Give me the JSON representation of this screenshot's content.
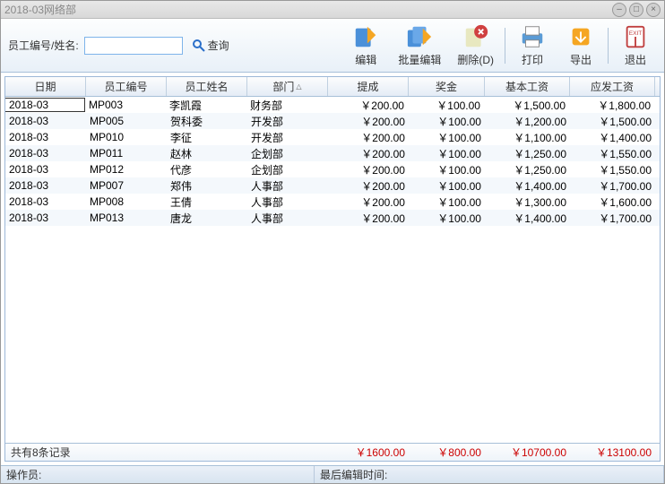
{
  "window": {
    "title": "2018-03网络部"
  },
  "search": {
    "label": "员工编号/姓名:",
    "value": "",
    "button": "查询"
  },
  "toolbar": {
    "edit": "编辑",
    "batch_edit": "批量编辑",
    "delete": "删除(D)",
    "print": "打印",
    "export": "导出",
    "exit": "退出"
  },
  "columns": [
    "日期",
    "员工编号",
    "员工姓名",
    "部门",
    "提成",
    "奖金",
    "基本工资",
    "应发工资"
  ],
  "rows": [
    {
      "date": "2018-03",
      "no": "MP003",
      "name": "李凯霞",
      "dept": "财务部",
      "comm": "￥200.00",
      "bonus": "￥100.00",
      "base": "￥1,500.00",
      "pay": "￥1,800.00"
    },
    {
      "date": "2018-03",
      "no": "MP005",
      "name": "贺科委",
      "dept": "开发部",
      "comm": "￥200.00",
      "bonus": "￥100.00",
      "base": "￥1,200.00",
      "pay": "￥1,500.00"
    },
    {
      "date": "2018-03",
      "no": "MP010",
      "name": "李征",
      "dept": "开发部",
      "comm": "￥200.00",
      "bonus": "￥100.00",
      "base": "￥1,100.00",
      "pay": "￥1,400.00"
    },
    {
      "date": "2018-03",
      "no": "MP011",
      "name": "赵林",
      "dept": "企划部",
      "comm": "￥200.00",
      "bonus": "￥100.00",
      "base": "￥1,250.00",
      "pay": "￥1,550.00"
    },
    {
      "date": "2018-03",
      "no": "MP012",
      "name": "代彦",
      "dept": "企划部",
      "comm": "￥200.00",
      "bonus": "￥100.00",
      "base": "￥1,250.00",
      "pay": "￥1,550.00"
    },
    {
      "date": "2018-03",
      "no": "MP007",
      "name": "郑伟",
      "dept": "人事部",
      "comm": "￥200.00",
      "bonus": "￥100.00",
      "base": "￥1,400.00",
      "pay": "￥1,700.00"
    },
    {
      "date": "2018-03",
      "no": "MP008",
      "name": "王倩",
      "dept": "人事部",
      "comm": "￥200.00",
      "bonus": "￥100.00",
      "base": "￥1,300.00",
      "pay": "￥1,600.00"
    },
    {
      "date": "2018-03",
      "no": "MP013",
      "name": "唐龙",
      "dept": "人事部",
      "comm": "￥200.00",
      "bonus": "￥100.00",
      "base": "￥1,400.00",
      "pay": "￥1,700.00"
    }
  ],
  "footer": {
    "count": "共有8条记录",
    "sum_comm": "￥1600.00",
    "sum_bonus": "￥800.00",
    "sum_base": "￥10700.00",
    "sum_pay": "￥13100.00"
  },
  "status": {
    "operator": "操作员:",
    "lastedit": "最后编辑时间:"
  }
}
